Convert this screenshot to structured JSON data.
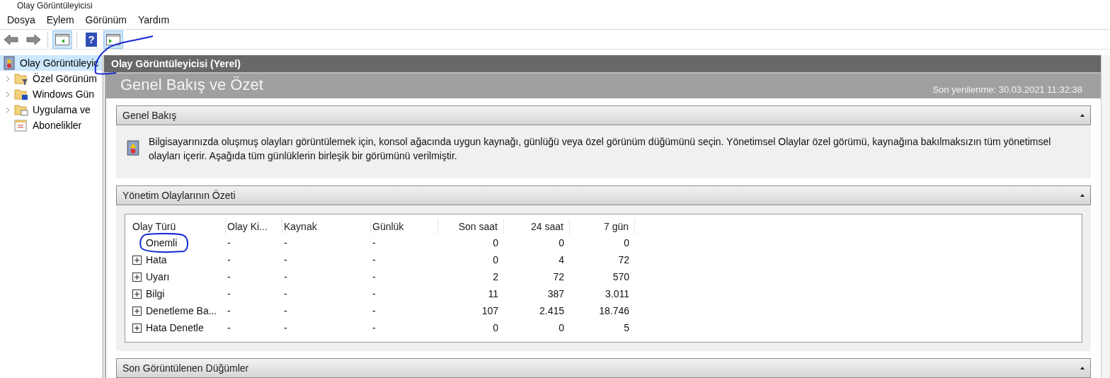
{
  "window": {
    "title": "Olay Görüntüleyicisi"
  },
  "menu": [
    "Dosya",
    "Eylem",
    "Görünüm",
    "Yardım"
  ],
  "toolbar": [
    {
      "kind": "back",
      "selected": false
    },
    {
      "kind": "forward",
      "selected": false
    },
    {
      "kind": "sep"
    },
    {
      "kind": "hide-tree",
      "selected": true
    },
    {
      "kind": "sep"
    },
    {
      "kind": "help",
      "symbol": "?",
      "selected": false
    },
    {
      "kind": "show-actions",
      "selected": true
    }
  ],
  "tree": {
    "label": "Olay Görüntüleyic",
    "selected": true,
    "children": [
      {
        "label": "Özel Görünüm",
        "expandable": true
      },
      {
        "label": "Windows Gün",
        "expandable": true
      },
      {
        "label": "Uygulama ve",
        "expandable": true
      },
      {
        "label": "Abonelikler",
        "expandable": false
      }
    ]
  },
  "pane": {
    "header": "Olay Görüntüleyicisi (Yerel)",
    "title": "Genel Bakış ve Özet",
    "refreshed": "Son yenilenme: 30.03.2021 11:32:38"
  },
  "sections": [
    {
      "title": "Genel Bakış",
      "expanded": true,
      "kind": "text",
      "text": "Bilgisayarınızda oluşmuş olayları görüntülemek için, konsol ağacında uygun kaynağı, günlüğü veya özel görünüm düğümünü seçin. Yönetimsel Olaylar özel görümü, kaynağına bakılmaksızın tüm yönetimsel olayları içerir. Aşağıda tüm günlüklerin birleşik bir görümünü verilmiştir."
    },
    {
      "title": "Yönetim Olaylarının Özeti",
      "expanded": true,
      "kind": "table",
      "columns": [
        "Olay Türü",
        "Olay Ki...",
        "Kaynak",
        "Günlük",
        "Son saat",
        "24 saat",
        "7 gün"
      ],
      "rows": [
        {
          "expandable": false,
          "cells": [
            "Onemli",
            "-",
            "-",
            "-",
            "0",
            "0",
            "0"
          ]
        },
        {
          "expandable": true,
          "cells": [
            "Hata",
            "-",
            "-",
            "-",
            "0",
            "4",
            "72"
          ]
        },
        {
          "expandable": true,
          "cells": [
            "Uyarı",
            "-",
            "-",
            "-",
            "2",
            "72",
            "570"
          ]
        },
        {
          "expandable": true,
          "cells": [
            "Bilgi",
            "-",
            "-",
            "-",
            "11",
            "387",
            "3.011"
          ]
        },
        {
          "expandable": true,
          "cells": [
            "Denetleme Ba...",
            "-",
            "-",
            "-",
            "107",
            "2.415",
            "18.746"
          ]
        },
        {
          "expandable": true,
          "cells": [
            "Hata Denetle",
            "-",
            "-",
            "-",
            "0",
            "0",
            "5"
          ]
        }
      ]
    },
    {
      "title": "Son Görüntülenen Düğümler",
      "expanded": true,
      "kind": "cut"
    }
  ]
}
